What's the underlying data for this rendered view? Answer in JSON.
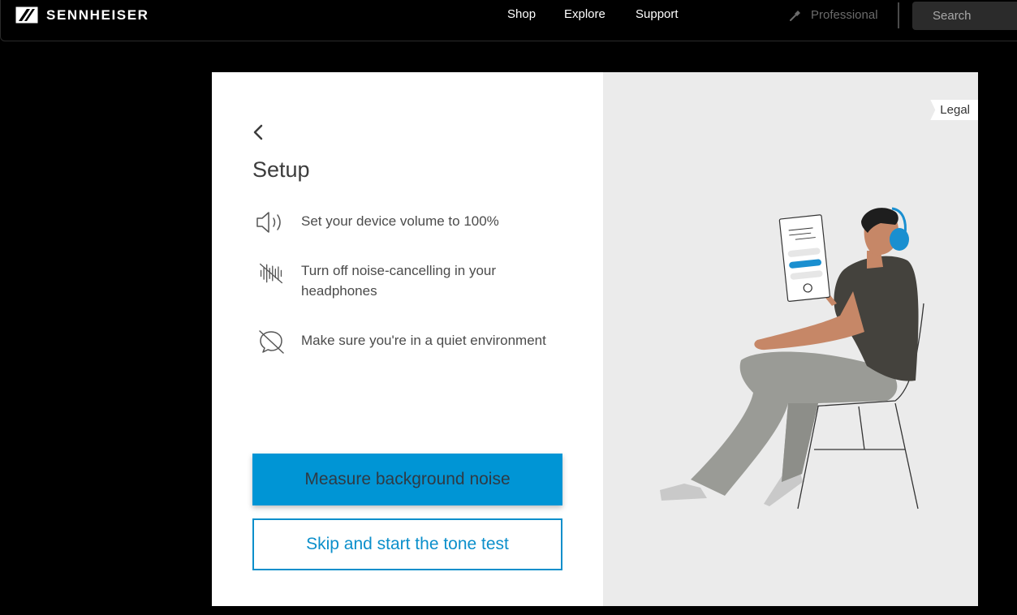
{
  "header": {
    "brand": "SENNHEISER",
    "nav": [
      {
        "label": "Shop"
      },
      {
        "label": "Explore"
      },
      {
        "label": "Support"
      }
    ],
    "professional_label": "Professional",
    "search_placeholder": "Search"
  },
  "setup": {
    "title": "Setup",
    "steps": [
      {
        "icon": "speaker-volume-icon",
        "text": "Set your device volume to 100%"
      },
      {
        "icon": "noise-cancelling-off-icon",
        "text": "Turn off noise-cancelling in your headphones"
      },
      {
        "icon": "quiet-environment-icon",
        "text": "Make sure you're in a quiet environment"
      }
    ],
    "primary_button": "Measure background noise",
    "secondary_button": "Skip and start the tone test"
  },
  "legal_label": "Legal",
  "colors": {
    "accent": "#0095d5",
    "accent_border": "#0b8fcb",
    "illustration_bg": "#ebebeb",
    "header_bg": "#000000"
  }
}
